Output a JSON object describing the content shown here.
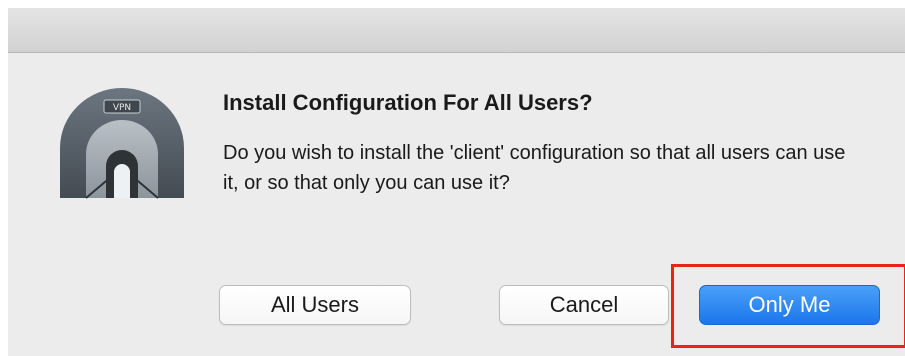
{
  "dialog": {
    "icon": "vpn-tunnel-icon",
    "icon_badge": "VPN",
    "title": "Install Configuration For All Users?",
    "message": "Do you wish to install the 'client' configuration so that all users can use it, or so that only you can use it?"
  },
  "buttons": {
    "all_users": "All Users",
    "cancel": "Cancel",
    "only_me": "Only Me"
  },
  "colors": {
    "primary": "#1b76ec",
    "highlight": "#e8241a"
  }
}
